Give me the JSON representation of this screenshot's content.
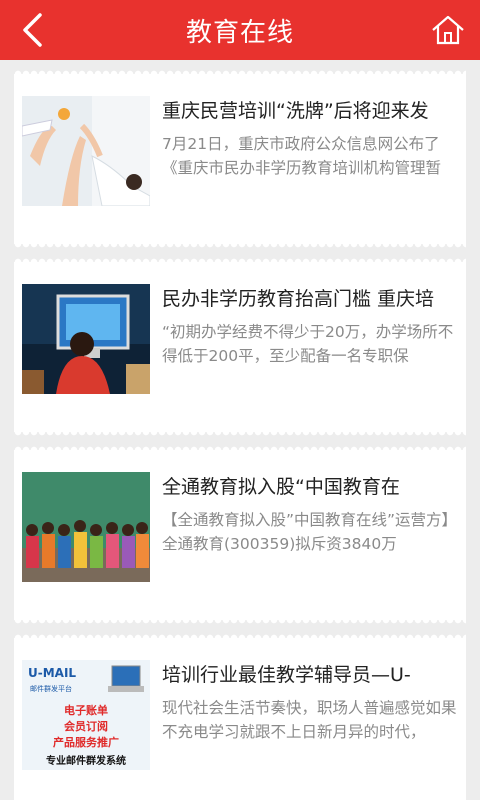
{
  "header": {
    "title": "教育在线",
    "back_icon": "back-chevron-icon",
    "home_icon": "home-icon",
    "bar_color": "#e8322e"
  },
  "articles": [
    {
      "title": "重庆民营培训“洗牌”后将迎来发",
      "summary": "7月21日，重庆市政府公众信息网公布了《重庆市民办非学历教育培训机构管理暂"
    },
    {
      "title": "民办非学历教育抬高门槛 重庆培",
      "summary": "“初期办学经费不得少于20万，办学场所不得低于200平，至少配备一名专职保"
    },
    {
      "title": "全通教育拟入股“中国教育在",
      "summary": "【全通教育拟入股”中国教育在线”运营方】全通教育(300359)拟斥资3840万"
    },
    {
      "title": "培训行业最佳教学辅导员—U-",
      "summary": "现代社会生活节奏快，职场人普遍感觉如果不充电学习就跟不上日新月异的时代，",
      "thumb_text": {
        "brand": "U-MAIL",
        "sub": "邮件群发平台",
        "line1": "电子账单",
        "line2": "会员订阅",
        "line3": "产品服务推广",
        "line4": "专业邮件群发系统"
      }
    }
  ]
}
